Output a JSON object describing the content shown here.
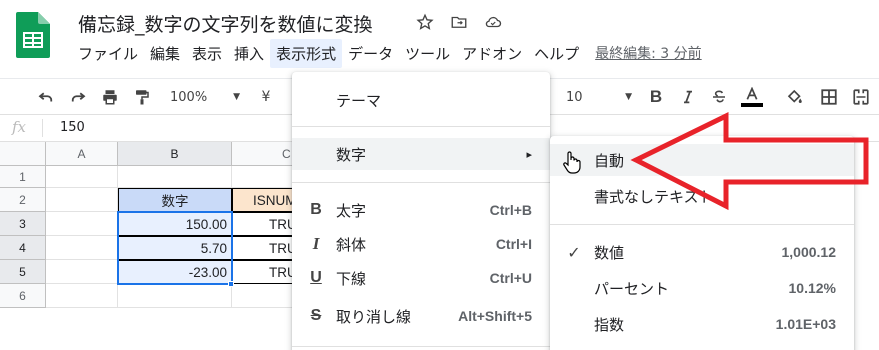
{
  "header": {
    "doc_title": "備忘録_数字の文字列を数値に変換",
    "icons": [
      "star-icon",
      "move-to-folder-icon",
      "cloud-saved-icon"
    ],
    "menu": [
      "ファイル",
      "編集",
      "表示",
      "挿入",
      "表示形式",
      "データ",
      "ツール",
      "アドオン",
      "ヘルプ"
    ],
    "active_menu": "表示形式",
    "last_edit": "最終編集: 3 分前"
  },
  "toolbar": {
    "zoom": "100%",
    "currency": "¥",
    "font_size": "10",
    "text_color": "#000000",
    "icons": [
      "undo-icon",
      "redo-icon",
      "print-icon",
      "paint-format-icon",
      "zoom-dropdown-icon",
      "currency-icon",
      "font-size-dropdown-icon",
      "bold-icon",
      "italic-icon",
      "strikethrough-icon",
      "text-color-icon",
      "fill-color-icon",
      "borders-icon",
      "merge-icon"
    ]
  },
  "formula_bar": {
    "fx_label": "fx",
    "value": "150"
  },
  "sheet": {
    "columns": [
      "A",
      "B",
      "C"
    ],
    "rows": [
      "1",
      "2",
      "3",
      "4",
      "5",
      "6"
    ],
    "header_b": "数字",
    "header_c": "ISNUM",
    "values_b": [
      "150.00",
      "5.70",
      "-23.00"
    ],
    "values_c": [
      "TRU",
      "TRU",
      "TRU"
    ]
  },
  "format_menu": {
    "theme": "テーマ",
    "number": "数字",
    "submenu_arrow": "▸",
    "bold": {
      "icon": "B",
      "label": "太字",
      "shortcut": "Ctrl+B"
    },
    "italic": {
      "icon": "I",
      "label": "斜体",
      "shortcut": "Ctrl+I"
    },
    "underline": {
      "icon": "U",
      "label": "下線",
      "shortcut": "Ctrl+U"
    },
    "strike": {
      "icon": "S",
      "label": "取り消し線",
      "shortcut": "Alt+Shift+5"
    }
  },
  "number_submenu": {
    "auto": "自動",
    "plain_text": "書式なしテキスト",
    "check": "✓",
    "number": {
      "label": "数値",
      "example": "1,000.12"
    },
    "percent": {
      "label": "パーセント",
      "example": "10.12%"
    },
    "scientific": {
      "label": "指数",
      "example": "1.01E+03"
    }
  },
  "colors": {
    "sheets_green": "#0f9d58",
    "header_fill_b": "#c9daf8",
    "header_fill_c": "#fce5cd",
    "selection_fill": "#e8f0fe",
    "selection_border": "#1a73e8",
    "annotation_red": "#e8232a"
  }
}
